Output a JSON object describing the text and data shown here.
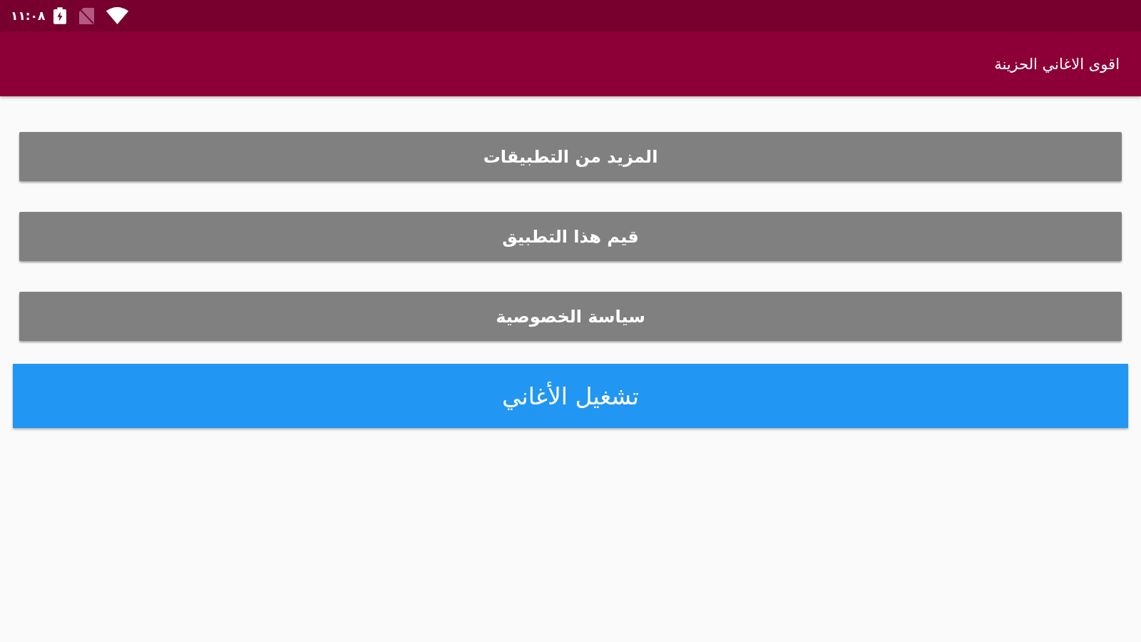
{
  "status_bar": {
    "time": "١١:٠٨"
  },
  "app_bar": {
    "title": "اقوى الاغاني الحزينة"
  },
  "buttons": [
    {
      "label": "المزيد من التطبيقات",
      "kind": "menu"
    },
    {
      "label": "قيم هذا التطبيق",
      "kind": "menu"
    },
    {
      "label": "سياسة الخصوصية",
      "kind": "menu"
    },
    {
      "label": "تشغيل الأغاني",
      "kind": "primary"
    }
  ]
}
